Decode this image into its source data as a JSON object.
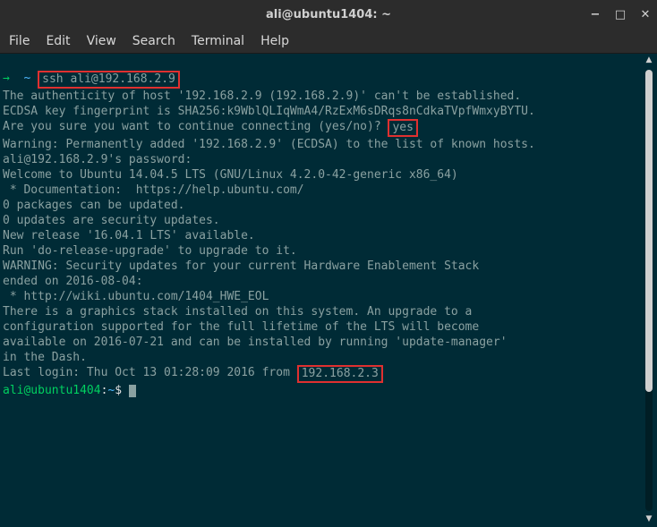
{
  "window": {
    "title": "ali@ubuntu1404: ~",
    "controls": {
      "minimize": "−",
      "maximize": "□",
      "close": "✕"
    }
  },
  "menubar": {
    "file": "File",
    "edit": "Edit",
    "view": "View",
    "search": "Search",
    "terminal": "Terminal",
    "help": "Help"
  },
  "prompt": {
    "arrow": "→",
    "tilde": "~",
    "cmd": "ssh ali@192.168.2.9"
  },
  "highlights": {
    "yes": "yes",
    "from_ip": "192.168.2.3"
  },
  "output": {
    "l1": "The authenticity of host '192.168.2.9 (192.168.2.9)' can't be established.",
    "l2": "ECDSA key fingerprint is SHA256:k9WblQLIqWmA4/RzExM6sDRqs8nCdkaTVpfWmxyBYTU.",
    "l3a": "Are you sure you want to continue connecting (yes/no)? ",
    "l4": "Warning: Permanently added '192.168.2.9' (ECDSA) to the list of known hosts.",
    "l5": "ali@192.168.2.9's password:",
    "l6": "Welcome to Ubuntu 14.04.5 LTS (GNU/Linux 4.2.0-42-generic x86_64)",
    "l7": "",
    "l8": " * Documentation:  https://help.ubuntu.com/",
    "l9": "",
    "l10": "0 packages can be updated.",
    "l11": "0 updates are security updates.",
    "l12": "",
    "l13": "New release '16.04.1 LTS' available.",
    "l14": "Run 'do-release-upgrade' to upgrade to it.",
    "l15": "",
    "l16": "",
    "l17": "WARNING: Security updates for your current Hardware Enablement Stack",
    "l18": "ended on 2016-08-04:",
    "l19": " * http://wiki.ubuntu.com/1404_HWE_EOL",
    "l20": "",
    "l21": "There is a graphics stack installed on this system. An upgrade to a",
    "l22": "configuration supported for the full lifetime of the LTS will become",
    "l23": "available on 2016-07-21 and can be installed by running 'update-manager'",
    "l24": "in the Dash.",
    "l25": "",
    "l26a": "Last login: Thu Oct 13 01:28:09 2016 from ",
    "l27a": "ali@ubuntu1404",
    "l27b": ":",
    "l27c": "~",
    "l27d": "$ "
  }
}
